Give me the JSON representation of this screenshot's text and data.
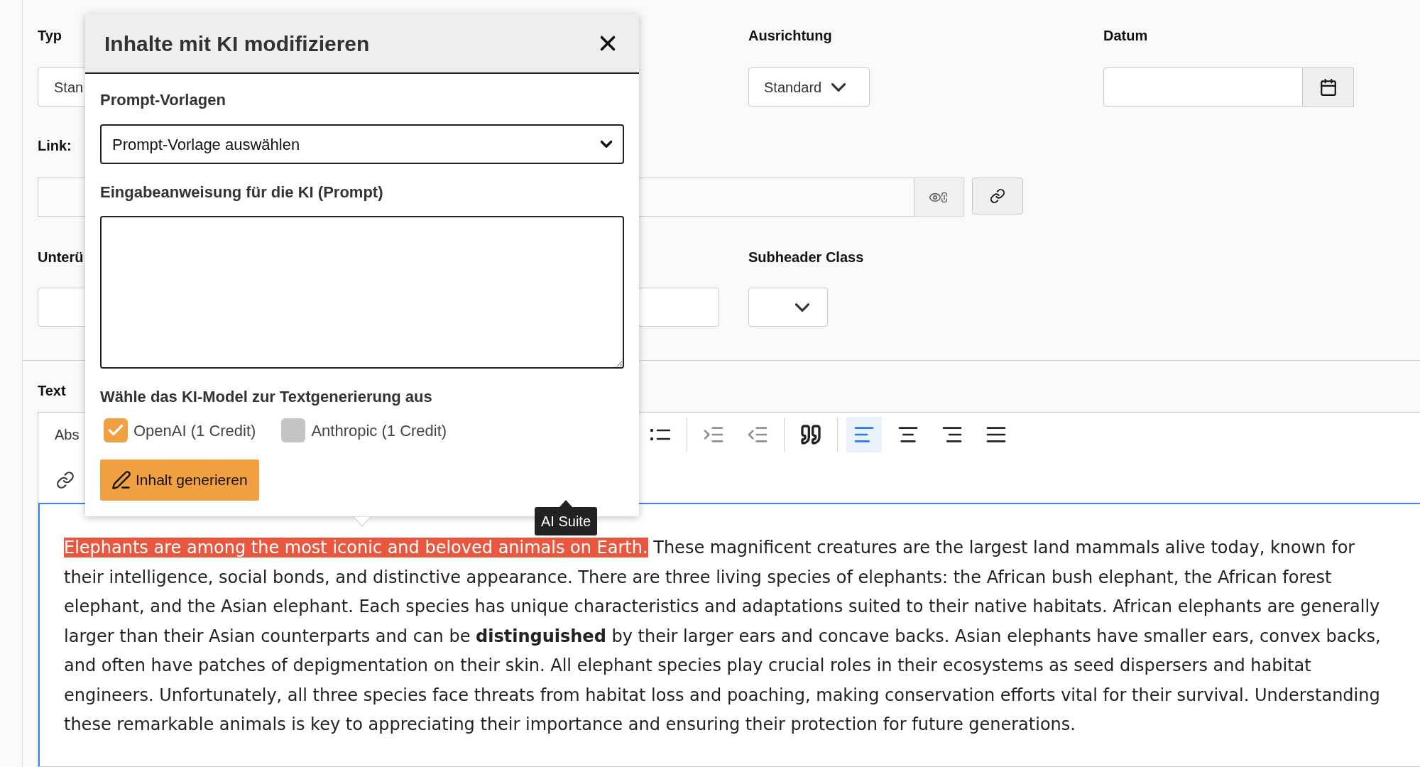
{
  "form": {
    "typ": {
      "label": "Typ",
      "value": "Stan"
    },
    "ausrichtung": {
      "label": "Ausrichtung",
      "value": "Standard"
    },
    "datum": {
      "label": "Datum"
    },
    "link": {
      "label": "Link:"
    },
    "field_5": {
      "label": "Unterü"
    },
    "subheader_class": {
      "label": "Subheader Class"
    }
  },
  "editor": {
    "label": "Text",
    "format": "Abs",
    "toolbar": [
      {
        "kind": "bullet-list",
        "selected": false,
        "disabled": false
      },
      {
        "kind": "divider"
      },
      {
        "kind": "indent",
        "selected": false,
        "disabled": true
      },
      {
        "kind": "outdent",
        "selected": false,
        "disabled": true
      },
      {
        "kind": "divider"
      },
      {
        "kind": "quote",
        "selected": false,
        "disabled": false
      },
      {
        "kind": "divider"
      },
      {
        "kind": "align-left",
        "selected": true,
        "disabled": false
      },
      {
        "kind": "align-center",
        "selected": false,
        "disabled": false
      },
      {
        "kind": "align-right",
        "selected": false,
        "disabled": false
      },
      {
        "kind": "align-justify",
        "selected": false,
        "disabled": false
      }
    ],
    "segments": [
      {
        "text": "Elephants are among the most iconic and beloved animals on Earth.",
        "selected": true
      },
      {
        "text": "These magnificent creatures are the largest land mammals alive today, known for their intelligence, social bonds, and distinctive appearance. There are three living species of elephants: the African bush elephant, the African forest elephant, and the Asian elephant. Each species has unique characteristics and adaptations suited to their native habitats. African elephants are generally larger than their Asian counterparts and can be **distinguished** by their larger ears and concave backs. Asian elephants have smaller ears, convex backs, and often have patches of depigmentation on their skin. All elephant species play crucial roles in their ecosystems as seed dispersers and habitat engineers. Unfortunately, all three species face threats from habitat loss and poaching, making conservation efforts vital for their survival. Understanding these remarkable animals is key to appreciating their importance and ensuring their protection for future generations.",
        "selected": false
      }
    ]
  },
  "dialog": {
    "title": "Inhalte mit KI modifizieren",
    "template_label": "Prompt-Vorlagen",
    "template_value": "Prompt-Vorlage auswählen",
    "prompt_label": "Eingabeanweisung für die KI (Prompt)",
    "model_label": "Wähle das KI-Model zur Textgenerierung aus",
    "models": [
      {
        "label": "OpenAI (1 Credit)",
        "checked": true
      },
      {
        "label": "Anthropic (1 Credit)",
        "checked": false
      }
    ],
    "generate_button": "Inhalt generieren"
  },
  "tooltip": "AI Suite"
}
